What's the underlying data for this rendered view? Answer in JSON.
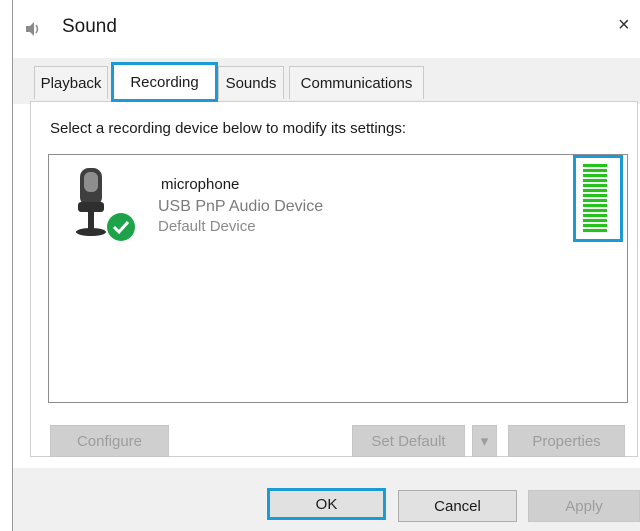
{
  "window": {
    "title": "Sound",
    "close_glyph": "×"
  },
  "tabs": [
    {
      "label": "Playback",
      "active": false
    },
    {
      "label": "Recording",
      "active": true
    },
    {
      "label": "Sounds",
      "active": false
    },
    {
      "label": "Communications",
      "active": false
    }
  ],
  "recording": {
    "instruction": "Select a recording device below to modify its settings:",
    "device": {
      "name": "microphone",
      "description": "USB PnP Audio Device",
      "status": "Default Device",
      "icon": "microphone-icon",
      "status_icon": "checkmark-icon",
      "level_meter": {
        "level": 1.0,
        "color": "#25c21d"
      }
    }
  },
  "buttons": {
    "configure": "Configure",
    "set_default": "Set Default",
    "set_default_arrow": "▾",
    "properties": "Properties",
    "ok": "OK",
    "cancel": "Cancel",
    "apply": "Apply"
  },
  "colors": {
    "highlight": "#1b9ad6",
    "meter_green": "#25c21d",
    "check_green": "#1fa34a"
  }
}
